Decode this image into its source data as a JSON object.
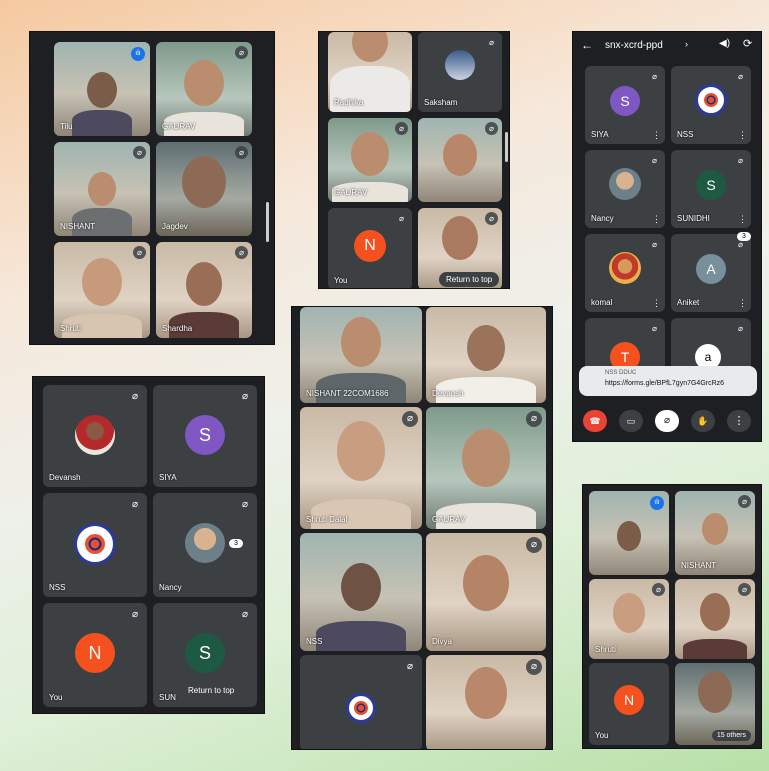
{
  "panel1": {
    "tiles": [
      "Tilu",
      "GAURAV",
      "NISHANT",
      "Jagdev",
      "Shruti",
      "Shardha"
    ]
  },
  "panel2": {
    "tiles": [
      "Radhika",
      "Saksham",
      "GAURAV",
      "",
      "You",
      ""
    ],
    "you_initial": "N",
    "return_to_top": "Return to top"
  },
  "panel3": {
    "meeting_code": "snx-xcrd-ppd",
    "participants": [
      {
        "name": "SIYA",
        "initial": "S",
        "color": "#7e57c2"
      },
      {
        "name": "NSS",
        "initial": ""
      },
      {
        "name": "Nancy",
        "initial": ""
      },
      {
        "name": "SUNIDHI",
        "initial": "S",
        "color": "#1e5a43"
      },
      {
        "name": "komal",
        "initial": ""
      },
      {
        "name": "Aniket",
        "initial": "A",
        "color": "#78909c"
      },
      {
        "name": "",
        "initial": "T",
        "color": "#f4511e"
      }
    ],
    "side_badge": "3",
    "chat_avatar": "a",
    "chat_sender": "NSS DDUC",
    "chat_message": "https://forms.gle/BPfL7gyn7G4GrcRz6"
  },
  "panel4": {
    "participants": [
      {
        "name": "Devansh",
        "initial": ""
      },
      {
        "name": "SIYA",
        "initial": "S",
        "color": "#7e57c2"
      },
      {
        "name": "NSS",
        "initial": ""
      },
      {
        "name": "Nancy",
        "initial": ""
      },
      {
        "name": "You",
        "initial": "N",
        "color": "#f4511e"
      },
      {
        "name": "SUN",
        "initial": "S",
        "color": "#1e5a43"
      }
    ],
    "side_badge": "3",
    "return_to_top": "Return to top"
  },
  "panel5": {
    "tiles": [
      "NISHANT 22COM1686",
      "Devansh",
      "Shruti Dalal",
      "GAURAV",
      "NSS",
      "Divya",
      "",
      ""
    ]
  },
  "panel6": {
    "tiles": [
      "",
      "NISHANT",
      "Shruti",
      "",
      "You",
      "15 others"
    ],
    "you_initial": "N"
  },
  "colors": {
    "hangup": "#ea4335",
    "panel_bg": "#1e1f22",
    "tile_bg": "#3c4043"
  }
}
